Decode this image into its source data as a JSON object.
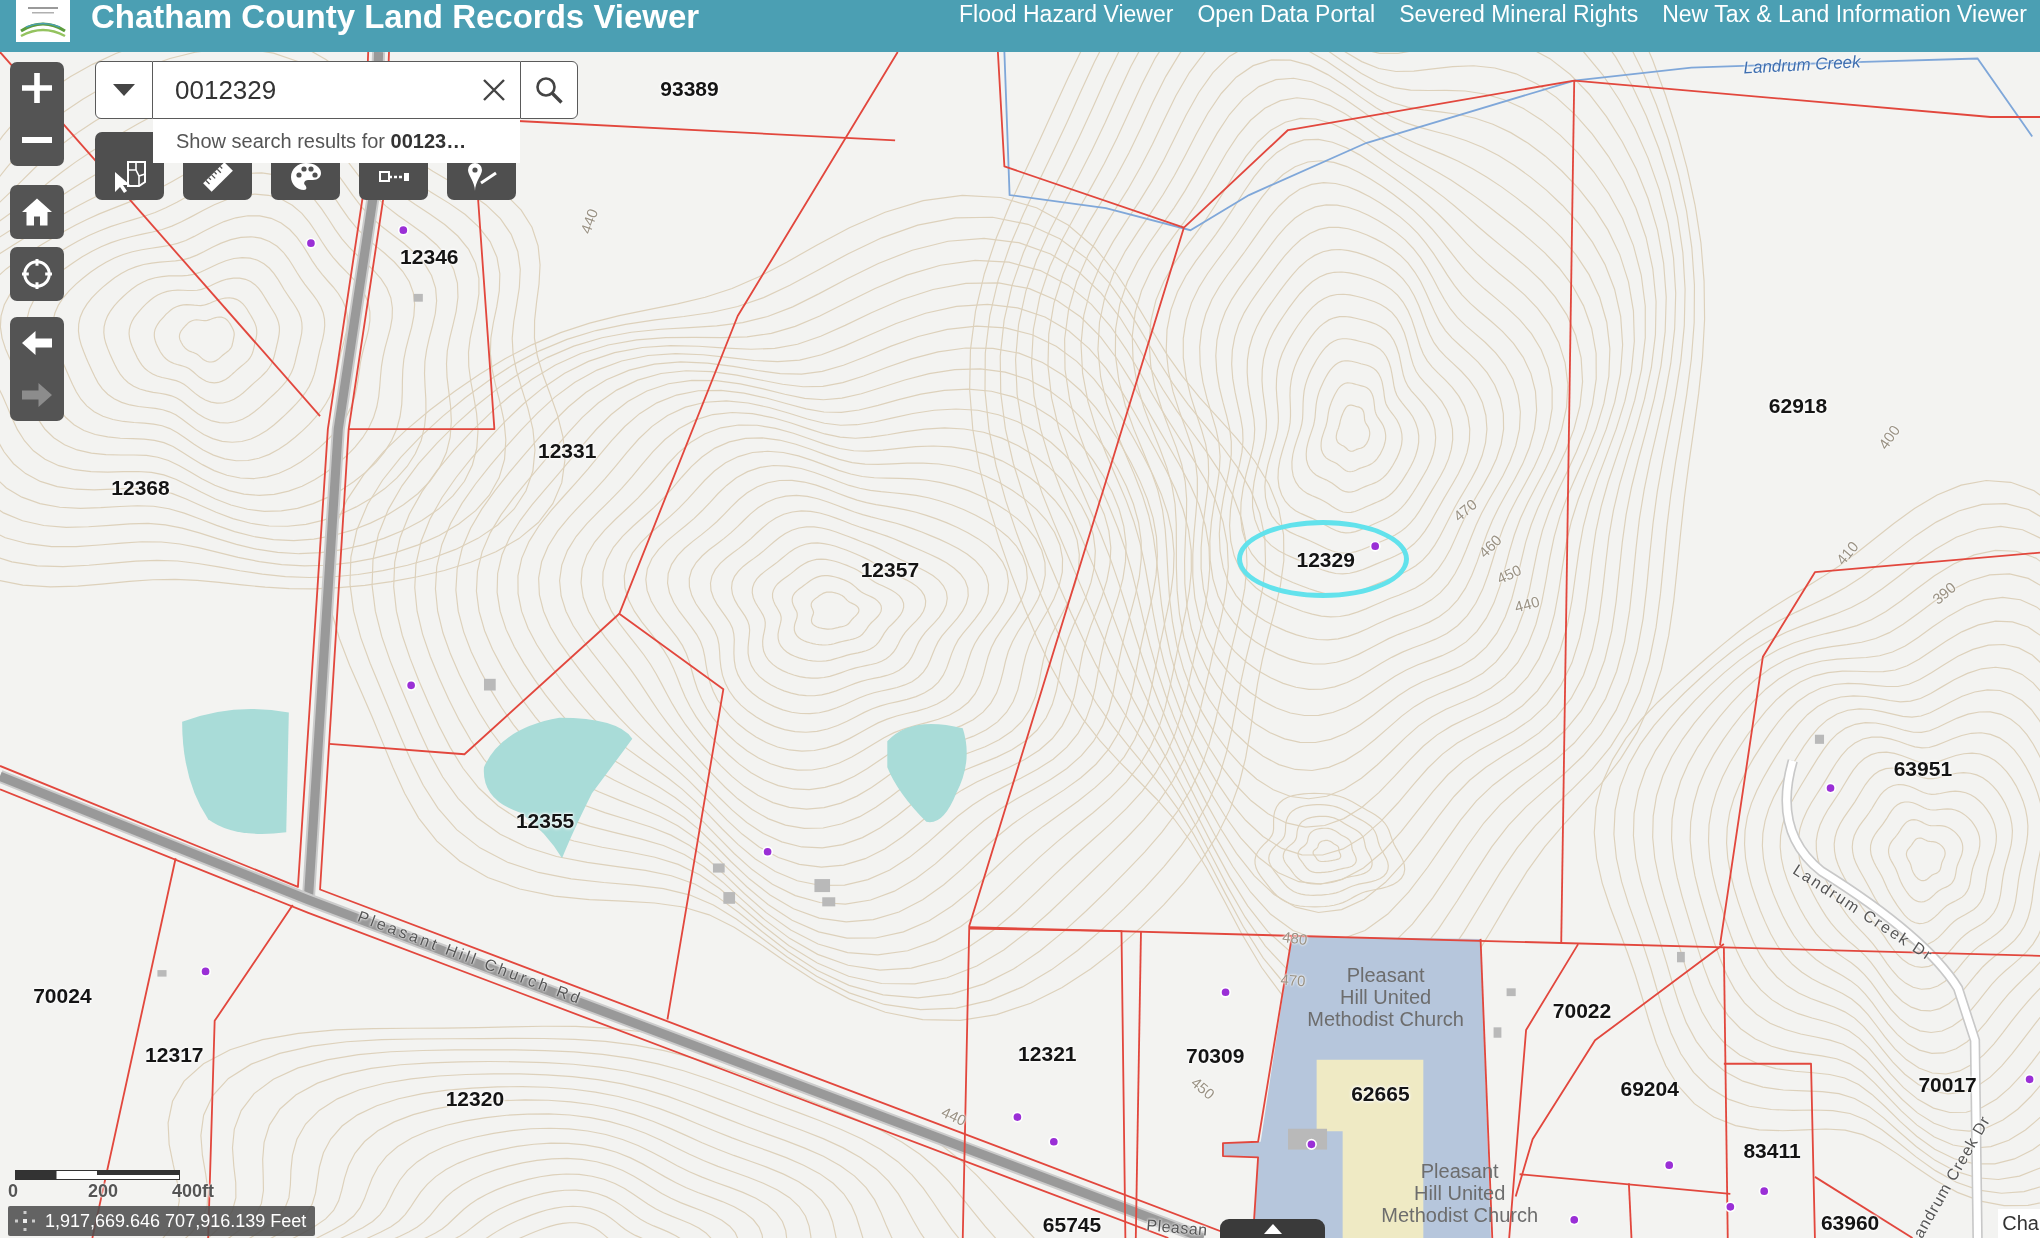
{
  "header": {
    "title": "Chatham County Land Records Viewer",
    "links": [
      "Flood Hazard Viewer",
      "Open Data Portal",
      "Severed Mineral Rights",
      "New Tax & Land Information Viewer"
    ]
  },
  "search": {
    "value": "0012329",
    "suggestion": "Show search results for **00123…**"
  },
  "navigation": [
    {
      "kind": "back",
      "disabled": false
    },
    {
      "kind": "forward",
      "disabled": true
    }
  ],
  "map": {
    "parcel_labels": [
      {
        "text": "93389",
        "selected": false
      },
      {
        "text": "12346",
        "selected": false
      },
      {
        "text": "12331",
        "selected": false
      },
      {
        "text": "12368",
        "selected": false
      },
      {
        "text": "12357",
        "selected": false
      },
      {
        "text": "12329",
        "selected": true
      },
      {
        "text": "62918",
        "selected": false
      },
      {
        "text": "63951",
        "selected": false
      },
      {
        "text": "12355",
        "selected": false
      },
      {
        "text": "70024",
        "selected": false
      },
      {
        "text": "12317",
        "selected": false
      },
      {
        "text": "12320",
        "selected": false
      },
      {
        "text": "12321",
        "selected": false
      },
      {
        "text": "70309",
        "selected": false
      },
      {
        "text": "62665",
        "selected": false
      },
      {
        "text": "70022",
        "selected": false
      },
      {
        "text": "69204",
        "selected": false
      },
      {
        "text": "70017",
        "selected": false
      },
      {
        "text": "83411",
        "selected": false
      },
      {
        "text": "63960",
        "selected": false
      },
      {
        "text": "65745",
        "selected": false
      }
    ],
    "contour_labels": [
      "440",
      "470",
      "460",
      "450",
      "440",
      "400",
      "410",
      "390",
      "440",
      "450",
      "480",
      "470"
    ],
    "road_labels": [
      "Pleasant Hill Church Rd",
      "Pleasan",
      "Landrum Creek Dr",
      "andrum Creek Dr"
    ],
    "water_labels": [
      "Landrum Creek"
    ],
    "place_labels": [
      "Pleasant\nHill United\nMethodist Church",
      "Pleasant\nHill United\nMethodist Church"
    ]
  },
  "scale_bar": {
    "ticks": [
      "0",
      "200",
      "400ft"
    ]
  },
  "coordinates": "1,917,669.646 707,916.139 Feet",
  "attribution": "Cha"
}
